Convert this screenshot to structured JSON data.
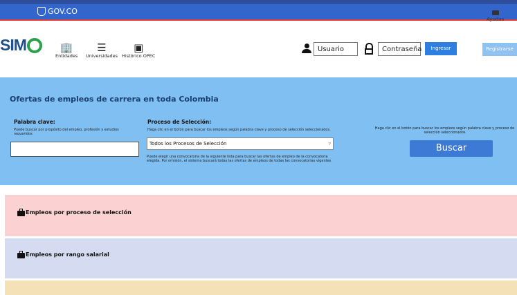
{
  "gov": {
    "label": "GOV.CO"
  },
  "header": {
    "logo_text": "SIM",
    "ayuda": "Ayudas",
    "nav": [
      {
        "label": "Entidades",
        "icon": "building-icon"
      },
      {
        "label": "Universidades",
        "icon": "list-check-icon"
      },
      {
        "label": "Histórico OPEC",
        "icon": "book-icon"
      }
    ],
    "login": {
      "username_placeholder": "Usuario",
      "password_placeholder": "Contraseña",
      "submit_label": "Ingresar",
      "register_label": "Registrarse"
    }
  },
  "search": {
    "title": "Ofertas de empleos de carrera en toda Colombia",
    "keyword": {
      "label": "Palabra clave:",
      "help": "Puede buscar por propósito del empleo, profesión y estudios requeridos",
      "value": ""
    },
    "process": {
      "label": "Proceso de Selección:",
      "help": "Haga clic en el botón para buscar los empleos según palabra clave y proceso de selección seleccionados.",
      "selected": "Todos los Procesos de Selección",
      "note": "Puede elegir una convocatoria de la siguiente lista para buscar las ofertas de empleo de la convocatoria elegida. Por omisión, el sistema buscará todas las ofertas de empleos de todas las convocatorias vigentes"
    },
    "right_help": "Haga clic en el botón para buscar los empleos según palabra clave y proceso de selección seleccionados",
    "button": "Buscar"
  },
  "cards": [
    {
      "label": "Empleos por proceso de selección",
      "icon": "briefcase-icon"
    },
    {
      "label": "Empleos por rango salarial",
      "icon": "briefcase-icon"
    }
  ],
  "colors": {
    "gov_bar": "#3366cc",
    "search_bg": "#7fbff2",
    "card_process": "#fcd1d1",
    "card_salary": "#d5dbf1",
    "card_next": "#f5e1b8",
    "primary_button": "#3d7ad6"
  }
}
